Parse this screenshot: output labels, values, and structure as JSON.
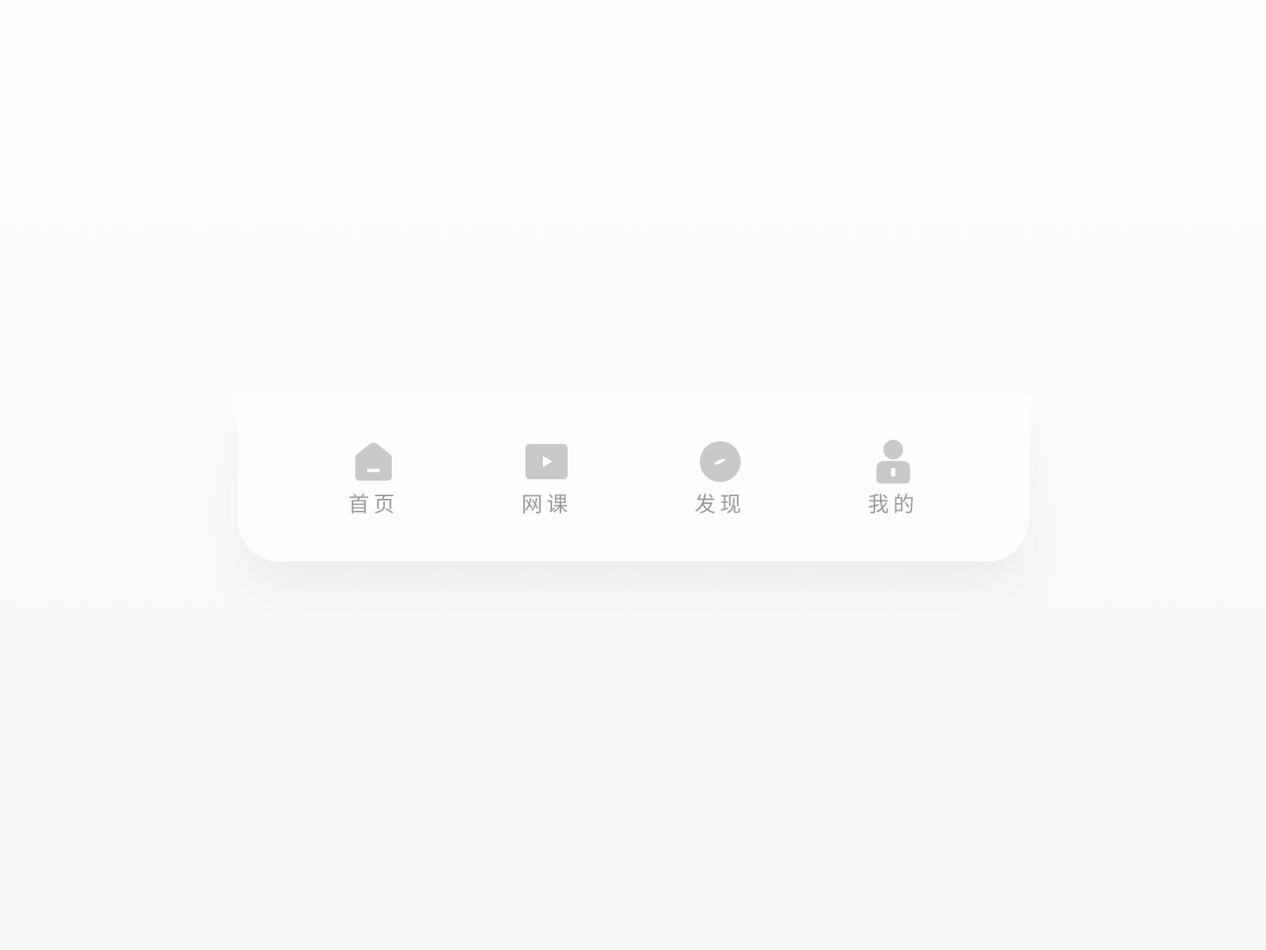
{
  "tabbar": {
    "accent_inactive": "#c9c9c9",
    "label_color": "#9b9b9b",
    "items": [
      {
        "label": "首页",
        "icon": "home-icon"
      },
      {
        "label": "网课",
        "icon": "video-play-icon"
      },
      {
        "label": "发现",
        "icon": "compass-icon"
      },
      {
        "label": "我的",
        "icon": "user-icon"
      }
    ]
  }
}
